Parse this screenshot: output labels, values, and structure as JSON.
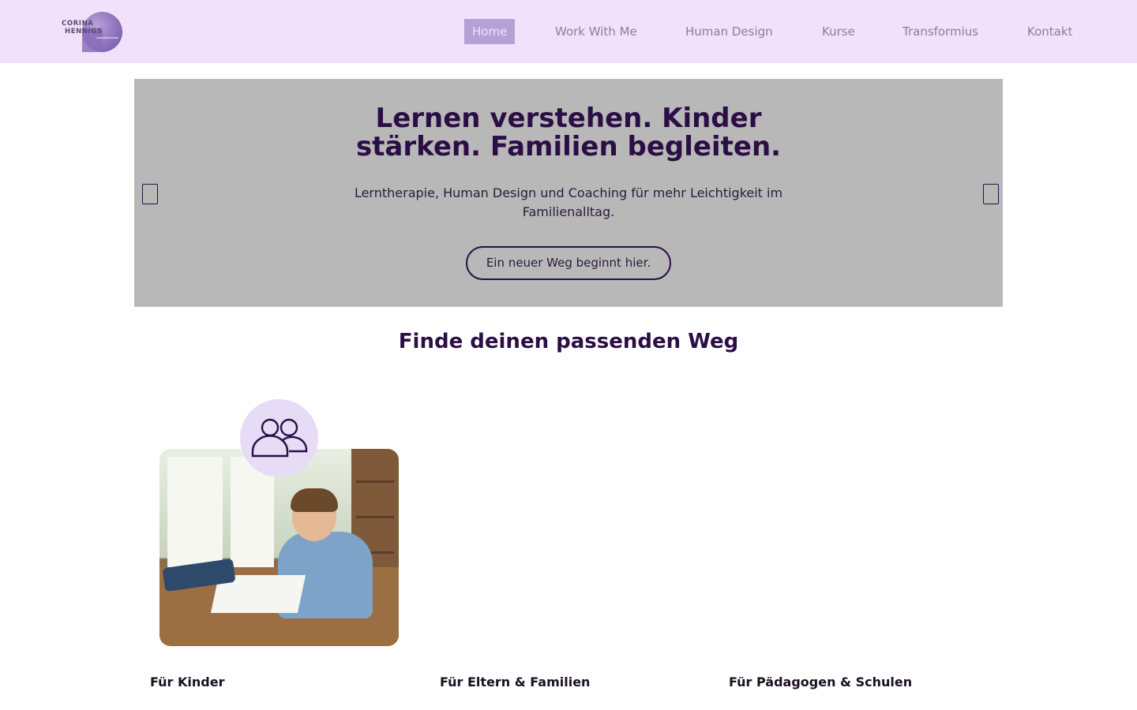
{
  "logo": {
    "line1": "CORINA",
    "line2": "HENNIGS"
  },
  "nav": {
    "items": [
      {
        "label": "Home",
        "active": true
      },
      {
        "label": "Work With Me",
        "active": false
      },
      {
        "label": "Human Design",
        "active": false
      },
      {
        "label": "Kurse",
        "active": false
      },
      {
        "label": "Transformius",
        "active": false
      },
      {
        "label": "Kontakt",
        "active": false
      }
    ]
  },
  "hero": {
    "title_line1": "Lernen verstehen. Kinder",
    "title_line2": "stärken. Familien begleiten.",
    "subtitle_line1": "Lerntherapie, Human Design und Coaching für mehr Leichtigkeit im",
    "subtitle_line2": "Familienalltag.",
    "button_label": "Ein neuer Weg beginnt hier.",
    "prev_icon": "carousel-prev-icon",
    "next_icon": "carousel-next-icon"
  },
  "section": {
    "title": "Finde deinen passenden Weg",
    "cards": [
      {
        "label": "Für Kinder",
        "icon": "users-icon"
      },
      {
        "label": "Für Eltern & Familien"
      },
      {
        "label": "Für Pädagogen & Schulen"
      }
    ]
  },
  "colors": {
    "header_bg": "#f2e1fb",
    "nav_active_bg": "#b7a0d6",
    "hero_bg": "#b8b8b8",
    "primary_text": "#2b0e45",
    "icon_circle_bg": "#e6dcf6"
  }
}
